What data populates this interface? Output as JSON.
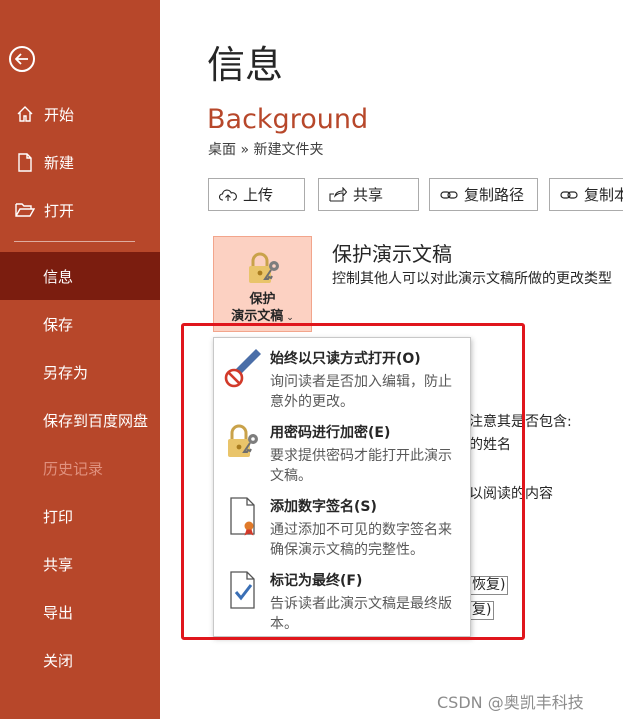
{
  "sidebar": {
    "top_items": [
      {
        "label": "开始",
        "icon": "home-icon"
      },
      {
        "label": "新建",
        "icon": "new-file-icon"
      },
      {
        "label": "打开",
        "icon": "folder-open-icon"
      }
    ],
    "items": [
      {
        "label": "信息",
        "selected": true
      },
      {
        "label": "保存"
      },
      {
        "label": "另存为"
      },
      {
        "label": "保存到百度网盘"
      },
      {
        "label": "历史记录",
        "disabled": true
      },
      {
        "label": "打印"
      },
      {
        "label": "共享"
      },
      {
        "label": "导出"
      },
      {
        "label": "关闭"
      }
    ]
  },
  "page": {
    "title": "信息",
    "doc_name": "Background",
    "breadcrumb": "桌面 » 新建文件夹"
  },
  "toolbar": {
    "upload": "上传",
    "share": "共享",
    "copy_path": "复制路径",
    "copy_link": "复制本"
  },
  "protect": {
    "tile_line1": "保护",
    "tile_line2": "演示文稿",
    "title": "保护演示文稿",
    "description": "控制其他人可以对此演示文稿所做的更改类型"
  },
  "background": {
    "inspect_fragment": "请注意其是否包含:",
    "author_fragment": "的姓名",
    "content_fragment": "以阅读的内容",
    "restore_btn_1": "恢复)",
    "restore_btn_2": "复)"
  },
  "menu": {
    "items": [
      {
        "title": "始终以只读方式打开(O)",
        "description": "询问读者是否加入编辑，防止意外的更改。",
        "icon": "pencil-no-edit-icon"
      },
      {
        "title": "用密码进行加密(E)",
        "description": "要求提供密码才能打开此演示文稿。",
        "icon": "lock-key-icon"
      },
      {
        "title": "添加数字签名(S)",
        "description": "通过添加不可见的数字签名来确保演示文稿的完整性。",
        "icon": "digital-signature-icon"
      },
      {
        "title": "标记为最终(F)",
        "description": "告诉读者此演示文稿是最终版本。",
        "icon": "mark-final-icon"
      }
    ]
  },
  "watermark": "CSDN @奥凯丰科技",
  "colors": {
    "sidebar": "#b7472a",
    "sidebar_selected": "#7b1d0f",
    "accent": "#b7472a",
    "highlight_box": "#e0161c"
  }
}
